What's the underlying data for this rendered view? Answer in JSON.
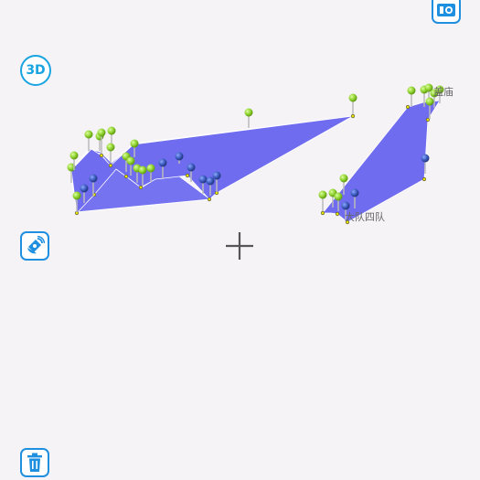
{
  "map": {
    "labels": [
      {
        "id": "lbl-1",
        "text": "盖庙"
      },
      {
        "id": "lbl-2",
        "text": "大队四队"
      }
    ],
    "polygon_fill": "#6f6cf0",
    "pin_green": "#8fd12f",
    "pin_blue": "#3b5bbf"
  },
  "controls": {
    "three_d_label": "3D",
    "camera_icon": "camera-icon",
    "locate_icon": "satellite-icon",
    "trash_icon": "trash-icon",
    "crosshair_icon": "crosshair-icon"
  },
  "colors": {
    "accent": "#1f8fe0",
    "background": "#f6f3f7"
  }
}
